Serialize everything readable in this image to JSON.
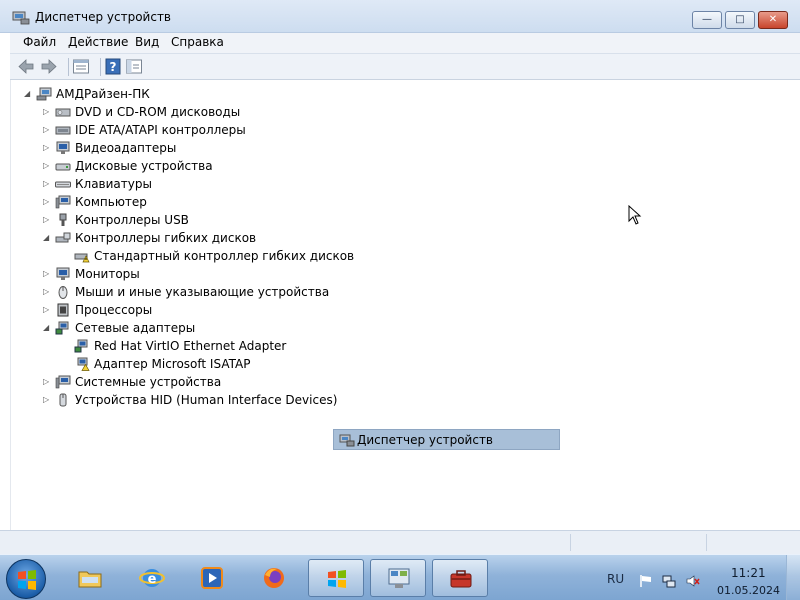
{
  "window": {
    "title": "Диспетчер устройств",
    "controls": {
      "minimize": "—",
      "maximize": "□",
      "close": "✕"
    }
  },
  "menu": [
    "Файл",
    "Действие",
    "Вид",
    "Справка"
  ],
  "toolbar": {
    "buttons": [
      "back-arrow-icon",
      "forward-arrow-icon",
      "properties-icon",
      "help-icon",
      "panel-icon"
    ]
  },
  "tree": {
    "root": "АМДРайзен-ПК",
    "items": [
      {
        "label": "DVD и CD-ROM дисководы",
        "icon": "dvd-drive-icon",
        "expanded": false
      },
      {
        "label": "IDE ATA/ATAPI контроллеры",
        "icon": "ide-controller-icon",
        "expanded": false
      },
      {
        "label": "Видеоадаптеры",
        "icon": "video-adapter-icon",
        "expanded": false
      },
      {
        "label": "Дисковые устройства",
        "icon": "disk-drive-icon",
        "expanded": false
      },
      {
        "label": "Клавиатуры",
        "icon": "keyboard-icon",
        "expanded": false
      },
      {
        "label": "Компьютер",
        "icon": "computer-icon",
        "expanded": false
      },
      {
        "label": "Контроллеры USB",
        "icon": "usb-icon",
        "expanded": false
      },
      {
        "label": "Контроллеры гибких дисков",
        "icon": "floppy-controller-icon",
        "expanded": true
      },
      {
        "label": "Стандартный контроллер гибких дисков",
        "icon": "floppy-controller-warning-icon",
        "child": true
      },
      {
        "label": "Мониторы",
        "icon": "monitor-icon",
        "expanded": false
      },
      {
        "label": "Мыши и иные указывающие устройства",
        "icon": "mouse-icon",
        "expanded": false
      },
      {
        "label": "Процессоры",
        "icon": "processor-icon",
        "expanded": false
      },
      {
        "label": "Сетевые адаптеры",
        "icon": "network-adapter-icon",
        "expanded": true
      },
      {
        "label": "Red Hat VirtIO Ethernet Adapter",
        "icon": "network-card-icon",
        "child": true
      },
      {
        "label": "Адаптер Microsoft ISATAP",
        "icon": "network-card-warning-icon",
        "child": true
      },
      {
        "label": "Системные устройства",
        "icon": "system-device-icon",
        "expanded": false
      },
      {
        "label": "Устройства HID (Human Interface Devices)",
        "icon": "hid-icon",
        "expanded": false
      }
    ]
  },
  "tooltip": {
    "label": "Диспетчер устройств"
  },
  "taskbar": {
    "apps": [
      "explorer-icon",
      "internet-explorer-icon",
      "media-player-icon",
      "firefox-icon",
      "windows-icon",
      "control-panel-icon",
      "device-manager-icon"
    ],
    "language": "RU",
    "time": "11:21",
    "date": "01.05.2024"
  },
  "colors": {
    "accent": "#cdddf0",
    "taskbar": "#8fb2d9",
    "tooltip": "#a8bfd8"
  }
}
